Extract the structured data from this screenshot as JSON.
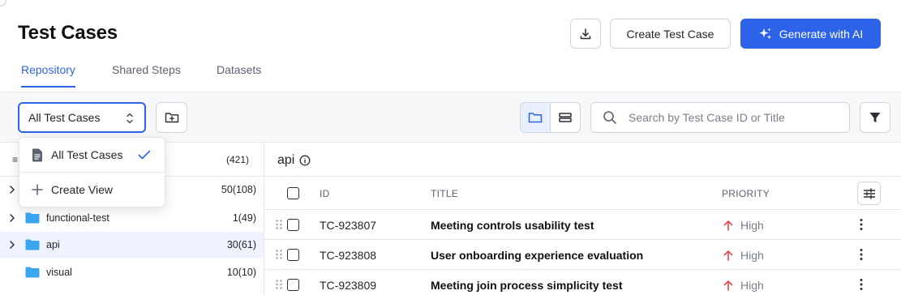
{
  "header": {
    "title": "Test Cases",
    "create_label": "Create Test Case",
    "ai_label": "Generate with AI"
  },
  "tabs": [
    {
      "label": "Repository",
      "active": true
    },
    {
      "label": "Shared Steps",
      "active": false
    },
    {
      "label": "Datasets",
      "active": false
    }
  ],
  "toolbar": {
    "view_select_value": "All Test Cases",
    "search_placeholder": "Search by Test Case ID or Title"
  },
  "dropdown": {
    "items": [
      {
        "label": "All Test Cases",
        "icon": "document-icon",
        "selected": true
      },
      {
        "label": "Create View",
        "icon": "plus-icon",
        "selected": false
      }
    ]
  },
  "sidebar": {
    "total_count": "(421)",
    "folders": [
      {
        "name": "",
        "count": "50(108)",
        "expandable": true,
        "selected": false
      },
      {
        "name": "functional-test",
        "count": "1(49)",
        "expandable": true,
        "selected": false
      },
      {
        "name": "api",
        "count": "30(61)",
        "expandable": true,
        "selected": true
      },
      {
        "name": "visual",
        "count": "10(10)",
        "expandable": false,
        "selected": false
      }
    ]
  },
  "main": {
    "folder_title": "api",
    "columns": {
      "id": "ID",
      "title": "TITLE",
      "priority": "PRIORITY"
    },
    "rows": [
      {
        "id": "TC-923807",
        "title": "Meeting controls usability test",
        "priority": "High"
      },
      {
        "id": "TC-923808",
        "title": "User onboarding experience evaluation",
        "priority": "High"
      },
      {
        "id": "TC-923809",
        "title": "Meeting join process simplicity test",
        "priority": "High"
      }
    ]
  },
  "colors": {
    "accent": "#2d63e8",
    "folder": "#3aa6f0",
    "priority_high": "#e5484d"
  }
}
